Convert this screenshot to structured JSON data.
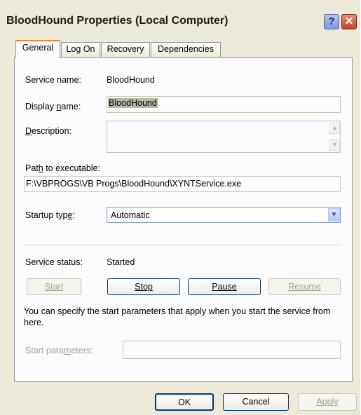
{
  "window": {
    "title": "BloodHound Properties (Local Computer)",
    "help_label": "?",
    "close_label": "✕"
  },
  "tabs": [
    {
      "label": "General",
      "active": true
    },
    {
      "label": "Log On",
      "active": false
    },
    {
      "label": "Recovery",
      "active": false
    },
    {
      "label": "Dependencies",
      "active": false
    }
  ],
  "general": {
    "service_name_label": "Service name:",
    "service_name_value": "BloodHound",
    "display_name_label": "Display name:",
    "display_name_value": "BloodHound",
    "description_label": "Description:",
    "description_value": "",
    "path_label": "Path to executable:",
    "path_value": "F:\\VBPROGS\\VB Progs\\BloodHound\\XYNTService.exe",
    "startup_type_label": "Startup type:",
    "startup_type_value": "Automatic",
    "service_status_label": "Service status:",
    "service_status_value": "Started",
    "buttons": {
      "start": {
        "label": "Start",
        "enabled": false
      },
      "stop": {
        "label": "Stop",
        "enabled": true
      },
      "pause": {
        "label": "Pause",
        "enabled": true
      },
      "resume": {
        "label": "Resume",
        "enabled": false
      }
    },
    "info_text": "You can specify the start parameters that apply when you start the service from here.",
    "start_params_label": "Start parameters:",
    "start_params_value": ""
  },
  "footer": {
    "ok_label": "OK",
    "cancel_label": "Cancel",
    "apply_label": "Apply",
    "apply_enabled": false
  },
  "icons": {
    "scroll_up": "chevron-up-icon",
    "scroll_down": "chevron-down-icon",
    "dropdown": "chevron-down-icon",
    "help": "question-icon",
    "close": "close-icon"
  }
}
